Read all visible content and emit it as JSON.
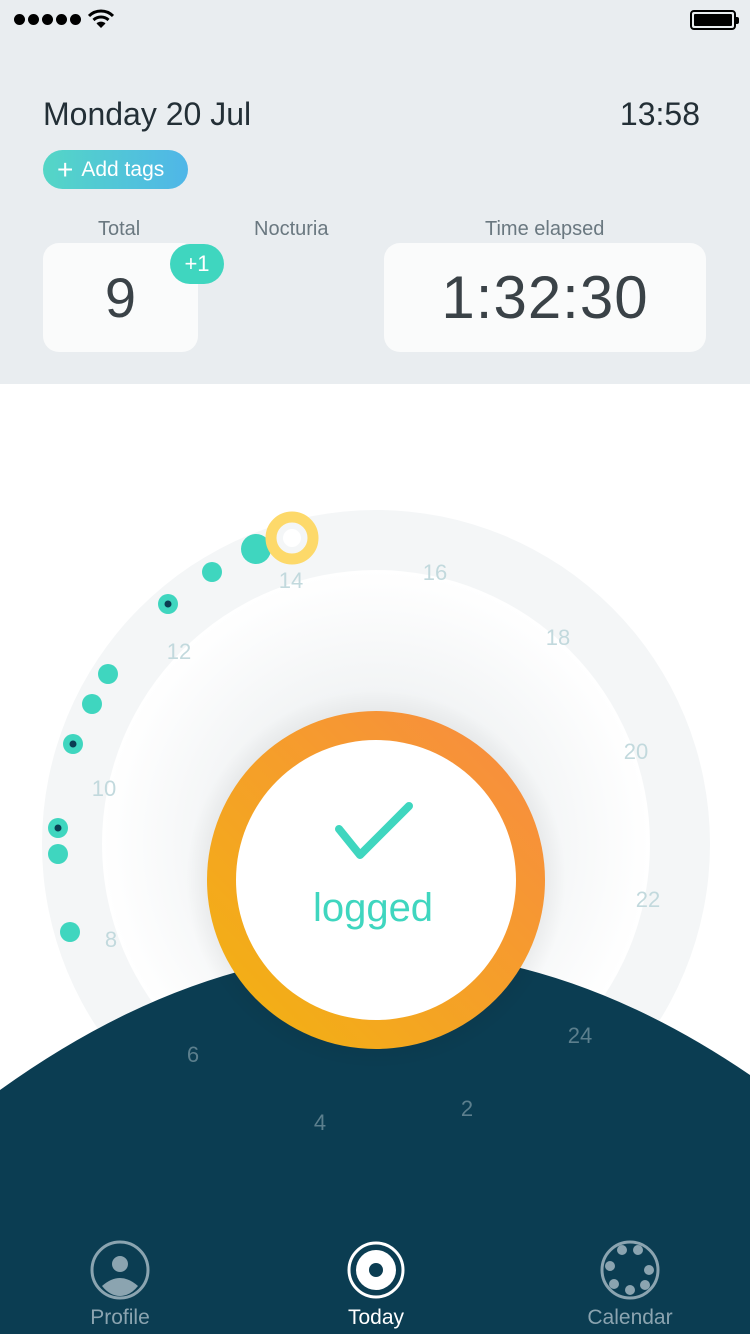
{
  "header": {
    "date": "Monday 20 Jul",
    "time": "13:58",
    "add_tags_label": "Add tags"
  },
  "stats": {
    "total_label": "Total",
    "total_value": "9",
    "nocturia_label": "Nocturia",
    "nocturia_badge": "+1",
    "elapsed_label": "Time elapsed",
    "elapsed_value": "1:32:30"
  },
  "dial": {
    "hour_labels": [
      "16",
      "18",
      "20",
      "22",
      "24",
      "2",
      "4",
      "6",
      "8",
      "10",
      "12",
      "14"
    ],
    "center_label": "logged",
    "colors": {
      "teal": "#3fd6bf",
      "orange": "#f6923f",
      "amber": "#f2b21c",
      "current": "#fdd96a",
      "night": "#0b3d52"
    }
  },
  "nav": {
    "items": [
      {
        "label": "Profile",
        "icon": "profile-icon"
      },
      {
        "label": "Today",
        "icon": "today-icon"
      },
      {
        "label": "Calendar",
        "icon": "calendar-icon"
      }
    ]
  }
}
